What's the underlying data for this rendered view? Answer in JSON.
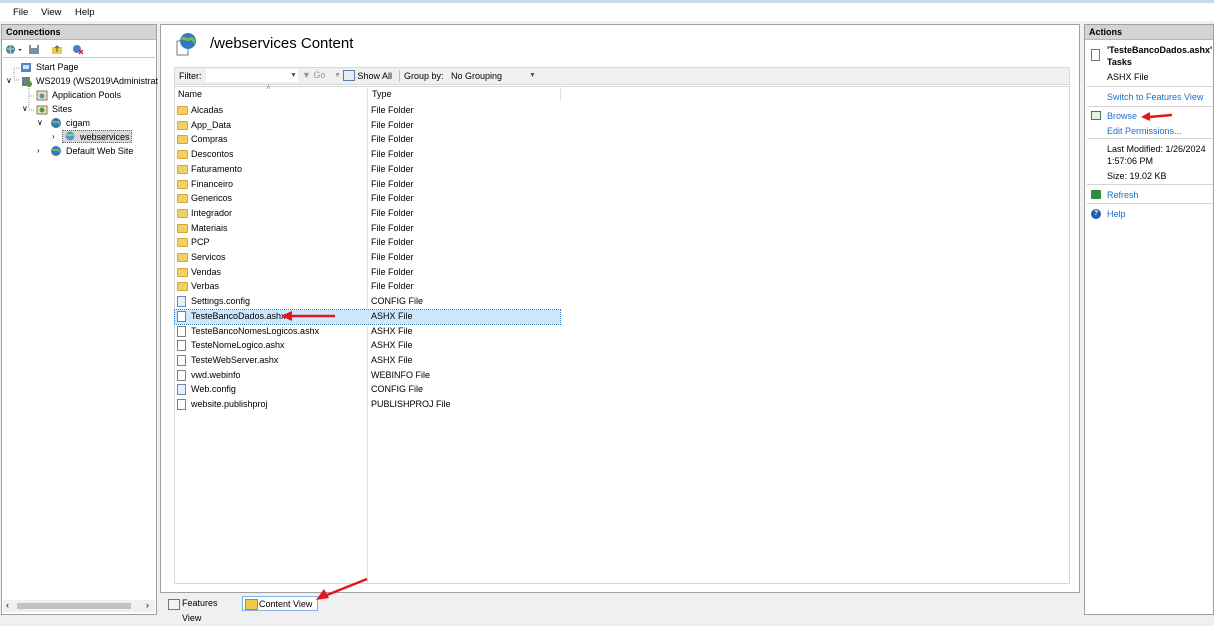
{
  "menu": {
    "file": "File",
    "view": "View",
    "help": "Help"
  },
  "connections": {
    "title": "Connections",
    "tree": {
      "start_page": "Start Page",
      "server": "WS2019 (WS2019\\Administrat",
      "app_pools": "Application Pools",
      "sites": "Sites",
      "cigam": "cigam",
      "webservices": "webservices",
      "default_site": "Default Web Site"
    }
  },
  "content": {
    "title": "/webservices Content",
    "filter_label": "Filter:",
    "go_label": "Go",
    "show_all": "Show All",
    "group_by_label": "Group by:",
    "group_by_value": "No Grouping",
    "columns": {
      "name": "Name",
      "type": "Type"
    },
    "rows": [
      {
        "name": "Alcadas",
        "type": "File Folder",
        "kind": "folder"
      },
      {
        "name": "App_Data",
        "type": "File Folder",
        "kind": "folder"
      },
      {
        "name": "Compras",
        "type": "File Folder",
        "kind": "folder"
      },
      {
        "name": "Descontos",
        "type": "File Folder",
        "kind": "folder"
      },
      {
        "name": "Faturamento",
        "type": "File Folder",
        "kind": "folder"
      },
      {
        "name": "Financeiro",
        "type": "File Folder",
        "kind": "folder"
      },
      {
        "name": "Genericos",
        "type": "File Folder",
        "kind": "folder"
      },
      {
        "name": "Integrador",
        "type": "File Folder",
        "kind": "folder"
      },
      {
        "name": "Materiais",
        "type": "File Folder",
        "kind": "folder"
      },
      {
        "name": "PCP",
        "type": "File Folder",
        "kind": "folder"
      },
      {
        "name": "Servicos",
        "type": "File Folder",
        "kind": "folder"
      },
      {
        "name": "Vendas",
        "type": "File Folder",
        "kind": "folder"
      },
      {
        "name": "Verbas",
        "type": "File Folder",
        "kind": "folder"
      },
      {
        "name": "Settings.config",
        "type": "CONFIG File",
        "kind": "config"
      },
      {
        "name": "TesteBancoDados.ashx",
        "type": "ASHX File",
        "kind": "file"
      },
      {
        "name": "TesteBancoNomesLogicos.ashx",
        "type": "ASHX File",
        "kind": "file"
      },
      {
        "name": "TesteNomeLogico.ashx",
        "type": "ASHX File",
        "kind": "file"
      },
      {
        "name": "TesteWebServer.ashx",
        "type": "ASHX File",
        "kind": "file"
      },
      {
        "name": "vwd.webinfo",
        "type": "WEBINFO File",
        "kind": "file"
      },
      {
        "name": "Web.config",
        "type": "CONFIG File",
        "kind": "config"
      },
      {
        "name": "website.publishproj",
        "type": "PUBLISHPROJ File",
        "kind": "file"
      }
    ],
    "selected_row": "TesteBancoDados.ashx"
  },
  "view_tabs": {
    "features": "Features View",
    "content": "Content View"
  },
  "actions": {
    "title": "Actions",
    "task_title_line1": "'TesteBancoDados.ashx'",
    "task_title_line2": "Tasks",
    "file_type": "ASHX File",
    "switch_features": "Switch to Features View",
    "browse": "Browse",
    "edit_permissions": "Edit Permissions...",
    "last_modified_line1": "Last Modified: 1/26/2024",
    "last_modified_line2": "1:57:06 PM",
    "size": "Size: 19.02 KB",
    "refresh": "Refresh",
    "help": "Help"
  },
  "colors": {
    "link": "#1c6ec7",
    "selection": "#cce8ff",
    "annotation_arrow": "#e8141b",
    "folder": "#f4cf62"
  }
}
